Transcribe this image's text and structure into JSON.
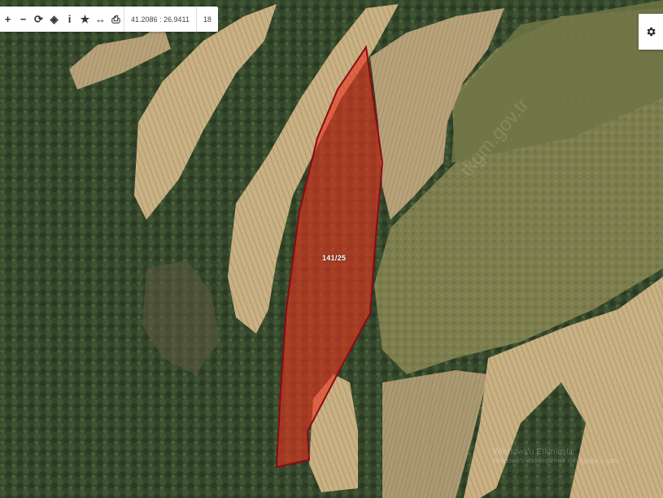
{
  "toolbar": {
    "tools": [
      {
        "name": "zoom-in-icon",
        "glyph": "+"
      },
      {
        "name": "zoom-out-icon",
        "glyph": "−"
      },
      {
        "name": "refresh-icon",
        "glyph": "⟳"
      },
      {
        "name": "locate-icon",
        "glyph": "◈"
      },
      {
        "name": "info-icon",
        "glyph": "i"
      },
      {
        "name": "star-icon",
        "glyph": "★"
      },
      {
        "name": "measure-icon",
        "glyph": "↔"
      },
      {
        "name": "print-icon",
        "glyph": "⎙"
      }
    ],
    "coordinates": "41.2086 : 26.9411",
    "zoom_level": "18"
  },
  "map": {
    "parcel_label": "141/25",
    "parcel_fill": "#e8331f",
    "parcel_stroke": "#8b0a14"
  },
  "watermark": {
    "line1": "Windows'u Etkinleştir",
    "line2": "Windows'u etkinleştirmek için Ayarlar'a gidin."
  },
  "site_watermark": "tkgm.gov.tr"
}
